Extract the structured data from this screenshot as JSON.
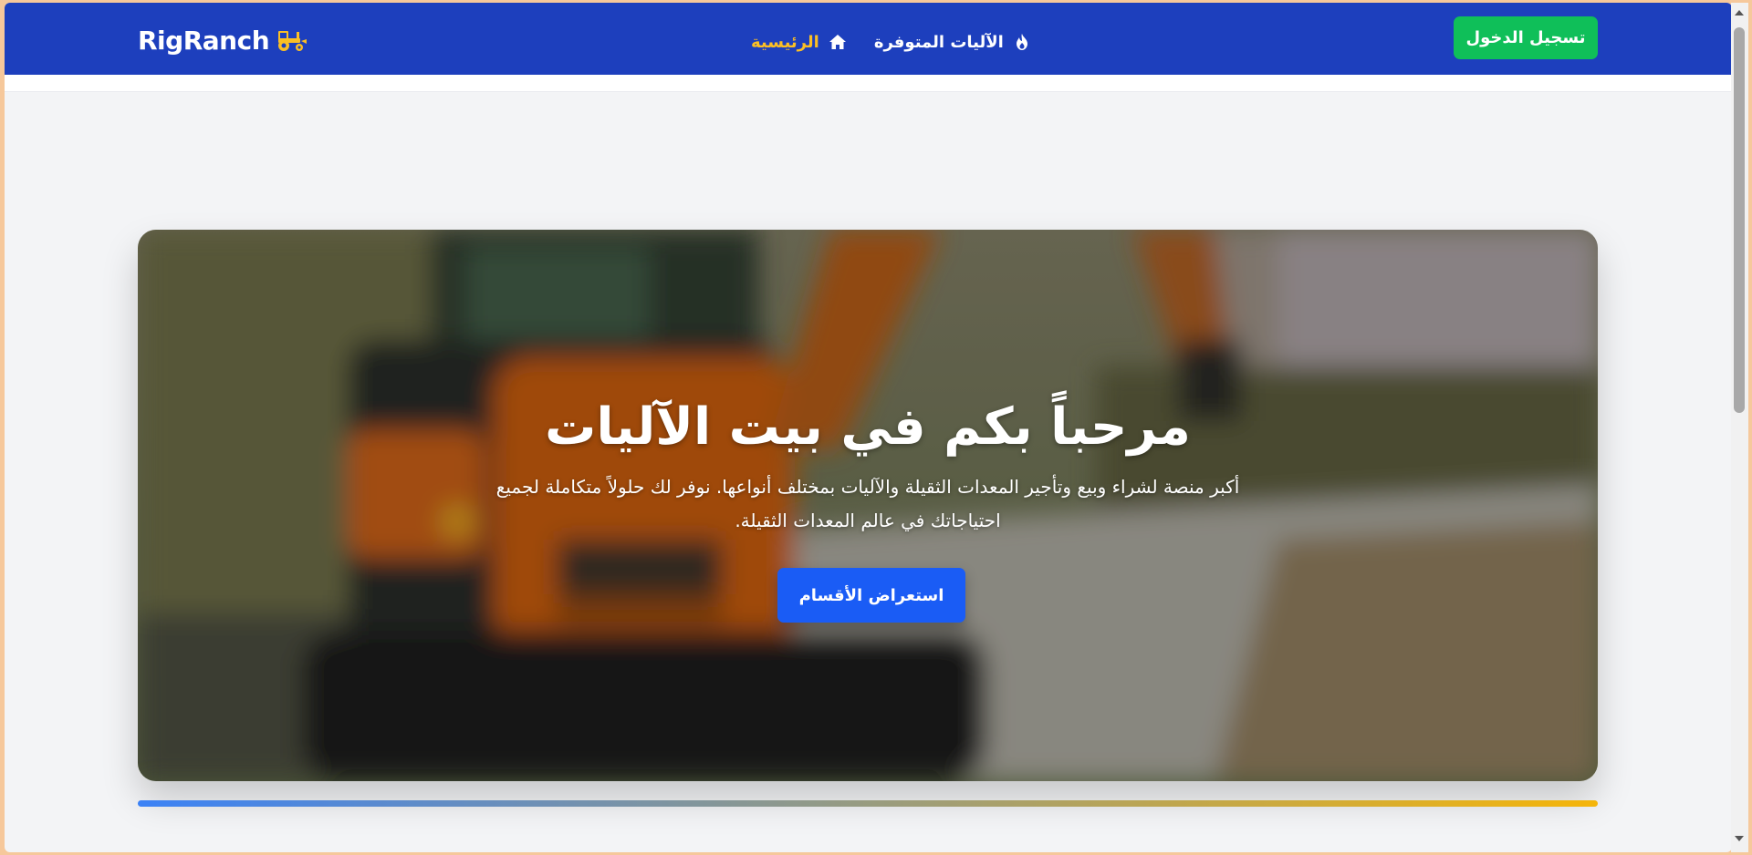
{
  "app": {
    "brand": "RigRanch",
    "brand_icon": "tractor-icon"
  },
  "navbar": {
    "links": [
      {
        "label": "الرئيسية",
        "icon": "home-icon",
        "active": true
      },
      {
        "label": "الآليات المتوفرة",
        "icon": "fire-icon",
        "active": false
      }
    ],
    "login_label": "تسجيل الدخول"
  },
  "hero": {
    "title": "مرحباً بكم في بيت الآليات",
    "subtitle": "أكبر منصة لشراء وبيع وتأجير المعدات الثقيلة والآليات بمختلف أنواعها. نوفر لك حلولاً متكاملة لجميع احتياجاتك في عالم المعدات الثقيلة.",
    "button_label": "استعراض الأقسام",
    "background": "blurred-excavator-photo"
  },
  "colors": {
    "navbar": "#1d3fbd",
    "active_link": "#fbbf24",
    "login_button": "#0fbf59",
    "hero_button": "#1a5cf5",
    "accent_from": "#3b82f6",
    "accent_to": "#f5b50a"
  }
}
